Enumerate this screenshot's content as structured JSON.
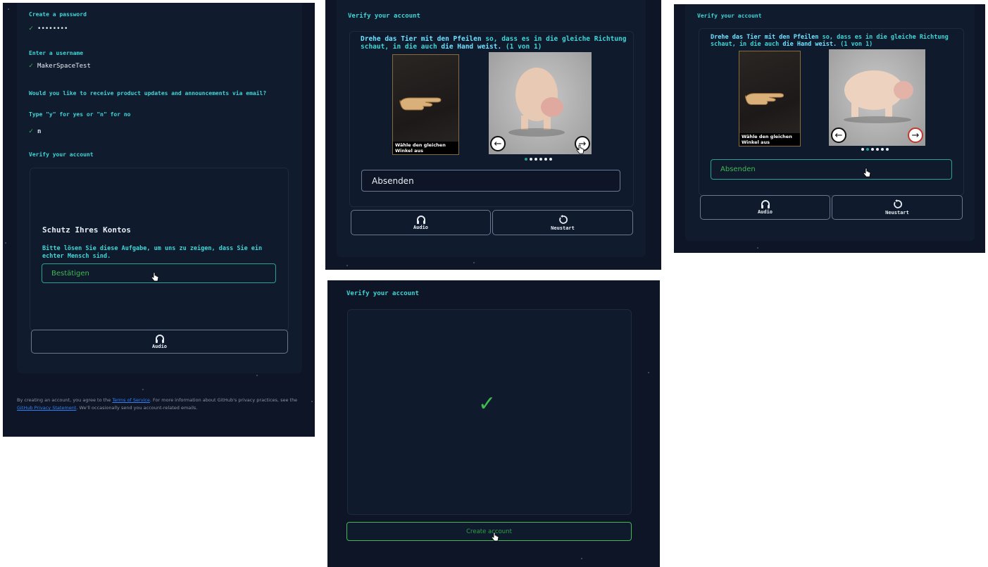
{
  "panel1": {
    "password_label": "Create a password",
    "password_value": "••••••••",
    "username_label": "Enter a username",
    "username_value": "MakerSpaceTest",
    "updates_question": "Would you like to receive product updates and announcements via email?",
    "updates_hint": "Type \"y\" for yes or \"n\" for no",
    "updates_value": "n",
    "verify_title": "Verify your account",
    "protect_title": "Schutz Ihres Kontos",
    "protect_text": "Bitte lösen Sie diese Aufgabe, um uns zu zeigen, dass Sie ein echter Mensch sind.",
    "confirm_button": "Bestätigen",
    "audio_label": "Audio",
    "footer_prefix": "By creating an account, you agree to the ",
    "footer_terms": "Terms of Service",
    "footer_middle": ". For more information about GitHub's privacy practices, see the ",
    "footer_privacy": "GitHub Privacy Statement",
    "footer_suffix": ". We'll occasionally send you account-related emails."
  },
  "panel2": {
    "verify_title": "Verify your account",
    "instruction_a": "Drehe das Tier mit den Pfeilen",
    "instruction_b": " so, dass es in die gleiche Richtung schaut, in die auch ",
    "instruction_c": "die Hand weist.",
    "instruction_d": " (1 von 1)",
    "caption": "Wähle den gleichen Winkel aus",
    "left_arrow": "←",
    "right_arrow": "→",
    "submit_label": "Absenden",
    "audio_label": "Audio",
    "restart_label": "Neustart"
  },
  "panel3": {
    "verify_title": "Verify your account",
    "instruction_a": "Drehe das Tier mit den Pfeilen",
    "instruction_b": " so, dass es in die gleiche Richtung schaut, in die auch ",
    "instruction_c": "die Hand weist.",
    "instruction_d": " (1 von 1)",
    "caption": "Wähle den gleichen Winkel aus",
    "left_arrow": "←",
    "right_arrow": "→",
    "submit_label": "Absenden",
    "audio_label": "Audio",
    "restart_label": "Neustart"
  },
  "panel4": {
    "verify_title": "Verify your account",
    "success_mark": "✓",
    "create_button": "Create account"
  },
  "colors": {
    "background": "#0d1526",
    "accent": "#3fd6d6",
    "success": "#3fb950"
  }
}
